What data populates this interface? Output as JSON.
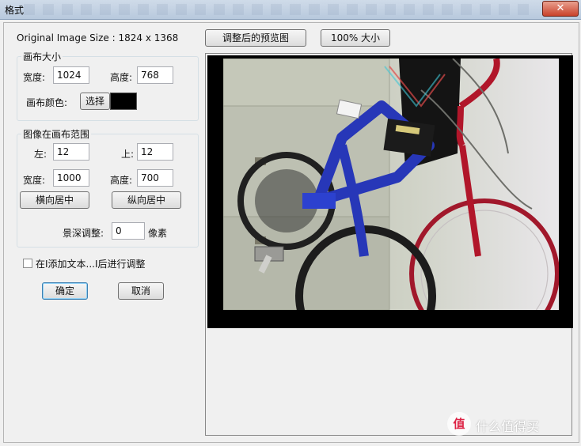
{
  "window": {
    "title": "格式",
    "close_symbol": "✕"
  },
  "left_panel": {
    "image_size_text": "Original Image Size : 1824 x 1368",
    "canvas_size_group": {
      "title": "画布大小",
      "width_label": "宽度:",
      "width_value": "1024",
      "height_label": "高度:",
      "height_value": "768",
      "color_label": "画布颜色:",
      "choose_button": "选择",
      "color_value": "#000000"
    },
    "image_range_group": {
      "title": "图像在画布范围",
      "left_label": "左:",
      "left_value": "12",
      "top_label": "上:",
      "top_value": "12",
      "width_label": "宽度:",
      "width_value": "1000",
      "height_label": "高度:",
      "height_value": "700",
      "center_h_button": "横向居中",
      "center_v_button": "纵向居中",
      "depth_label": "景深调整:",
      "depth_value": "0",
      "depth_unit": "像素"
    },
    "checkbox_label": "在I添加文本...I后进行调整",
    "checkbox_checked": false,
    "ok_button": "确定",
    "cancel_button": "取消"
  },
  "preview": {
    "preview_button": "调整后的预览图",
    "full_size_button": "100% 大小"
  },
  "watermark": {
    "icon_glyph": "值",
    "text": "什么值得买"
  }
}
